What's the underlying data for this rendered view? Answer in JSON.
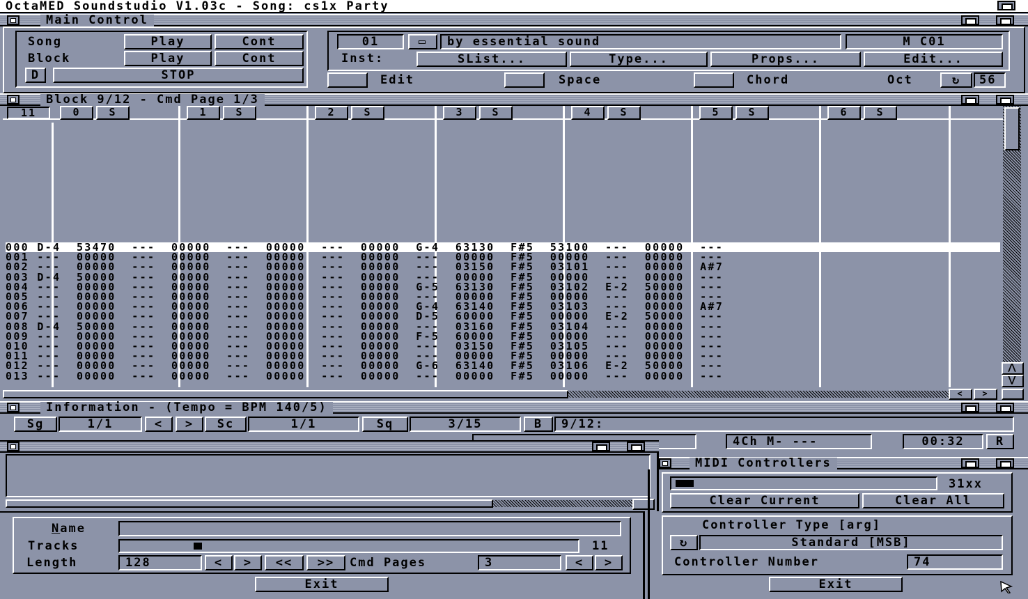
{
  "screen_title": "OctaMED Soundstudio V1.03c - Song: cs1x Party",
  "main": {
    "title": "Main Control",
    "song_label": "Song",
    "block_label": "Block",
    "play": "Play",
    "cont": "Cont",
    "d_btn": "D",
    "stop": "STOP",
    "inst_num": "01",
    "inst_name": "by essential sound",
    "midi_chan": "M C01",
    "inst_label": "Inst:",
    "slist": "SList...",
    "type": "Type...",
    "props": "Props...",
    "edit_btn": "Edit...",
    "edit_toggle": "Edit",
    "space_toggle": "Space",
    "chord_toggle": "Chord",
    "oct_label": "Oct",
    "oct_value": "56"
  },
  "block": {
    "title": "Block 9/12 - Cmd Page 1/3",
    "track_count": "11",
    "solo": "S",
    "tracks": [
      "0",
      "1",
      "2",
      "3",
      "4",
      "5",
      "6"
    ],
    "rows": [
      "000 D-4  53470  ---  00000  ---  00000  ---  00000  G-4  63130  F#5  53100  ---  00000  ---",
      "001 ---  00000  ---  00000  ---  00000  ---  00000  ---  00000  F#5  00000  ---  00000  ---",
      "002 ---  00000  ---  00000  ---  00000  ---  00000  ---  03150  F#5  03101  ---  00000  A#7",
      "003 D-4  50000  ---  00000  ---  00000  ---  00000  ---  00000  F#5  00000  ---  00000  ---",
      "004 ---  00000  ---  00000  ---  00000  ---  00000  G-5  63130  F#5  03102  E-2  50000  ---",
      "005 ---  00000  ---  00000  ---  00000  ---  00000  ---  00000  F#5  00000  ---  00000  ---",
      "006 ---  00000  ---  00000  ---  00000  ---  00000  G-4  63140  F#5  03103  ---  00000  A#7",
      "007 ---  00000  ---  00000  ---  00000  ---  00000  D-5  60000  F#5  00000  E-2  50000  ---",
      "008 D-4  50000  ---  00000  ---  00000  ---  00000  ---  03160  F#5  03104  ---  00000  ---",
      "009 ---  00000  ---  00000  ---  00000  ---  00000  F-5  60000  F#5  00000  ---  00000  ---",
      "010 ---  00000  ---  00000  ---  00000  ---  00000  ---  03150  F#5  03105  ---  00000  ---",
      "011 ---  00000  ---  00000  ---  00000  ---  00000  ---  00000  F#5  00000  ---  00000  ---",
      "012 ---  00000  ---  00000  ---  00000  ---  00000  G-6  63140  F#5  03106  E-2  50000  ---",
      "013 ---  00000  ---  00000  ---  00000  ---  00000  ---  00000  F#5  00000  ---  00000  ---"
    ]
  },
  "info": {
    "title": "Information - (Tempo = BPM 140/5)",
    "sg": "Sg",
    "sg_val": "1/1",
    "sc": "Sc",
    "sc_val": "1/1",
    "sq": "Sq",
    "sq_val": "3/15",
    "b": "B",
    "b_val": "9/12:",
    "chan_info": "4Ch M- ---",
    "time": "00:32",
    "r": "R"
  },
  "midi": {
    "title": "MIDI Controllers",
    "ctrl_value": "31xx",
    "clear_current": "Clear Current",
    "clear_all": "Clear All",
    "ctrl_type_label": "Controller Type [arg]",
    "ctrl_type": "Standard [MSB]",
    "ctrl_number_label": "Controller Number",
    "ctrl_number": "74",
    "exit": "Exit"
  },
  "props": {
    "name_label": "Name",
    "tracks_label": "Tracks",
    "tracks_value": "11",
    "length_label": "Length",
    "length_value": "128",
    "cmd_pages_label": "Cmd Pages",
    "cmd_pages_value": "3",
    "exit": "Exit"
  },
  "icons": {
    "close": "close-icon",
    "depth": "depth-icon",
    "zoom": "zoom-icon"
  }
}
